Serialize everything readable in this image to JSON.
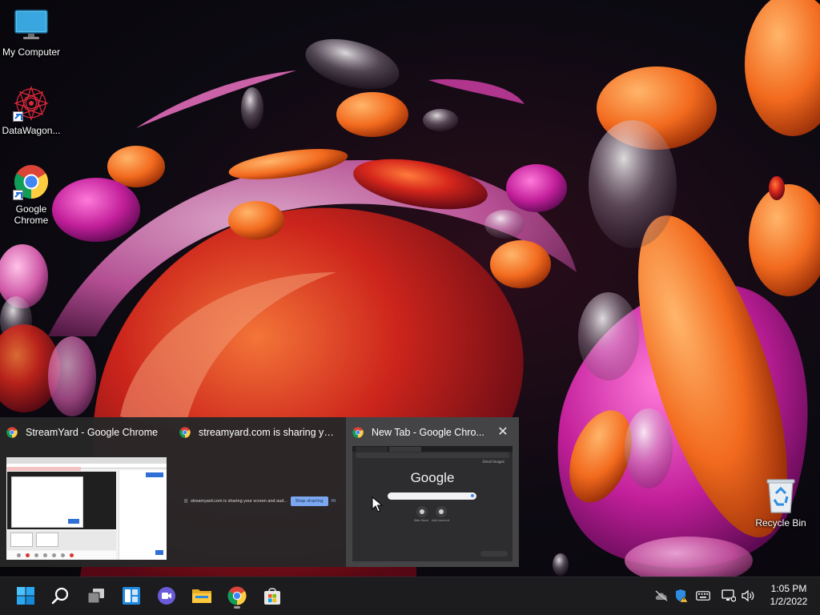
{
  "desktop": {
    "icons": [
      {
        "label": "My Computer",
        "icon": "monitor-icon"
      },
      {
        "label": "DataWagon...",
        "icon": "datawagon-icon"
      },
      {
        "label": "Google Chrome",
        "icon": "chrome-icon"
      },
      {
        "label": "Recycle Bin",
        "icon": "recycle-bin-icon"
      }
    ]
  },
  "task_preview": {
    "windows": [
      {
        "title": "StreamYard - Google Chrome",
        "icon": "chrome-icon"
      },
      {
        "title": "streamyard.com is sharing yo...",
        "icon": "chrome-icon",
        "preview": {
          "pause": "II",
          "message": "streamyard.com is sharing your screen and aud...",
          "stop_label": "Stop sharing",
          "hide_label": "Hi"
        }
      },
      {
        "title": "New Tab - Google Chro...",
        "icon": "chrome-icon",
        "preview": {
          "logo": "Google",
          "links": "Gmail  Images",
          "shortcut_1": "Web Store",
          "shortcut_2": "Add shortcut"
        }
      }
    ],
    "close_label": "✕"
  },
  "taskbar": {
    "apps": [
      {
        "name": "Start",
        "icon": "windows-start-icon"
      },
      {
        "name": "Search",
        "icon": "search-icon"
      },
      {
        "name": "Task View",
        "icon": "task-view-icon"
      },
      {
        "name": "Widgets",
        "icon": "widgets-icon"
      },
      {
        "name": "Chat",
        "icon": "chat-icon"
      },
      {
        "name": "File Explorer",
        "icon": "folder-icon"
      },
      {
        "name": "Google Chrome",
        "icon": "chrome-icon"
      },
      {
        "name": "Microsoft Store",
        "icon": "store-icon"
      }
    ],
    "tray": [
      "onedrive-icon",
      "security-icon",
      "keyboard-icon",
      "network-icon",
      "volume-icon"
    ],
    "clock": {
      "time": "1:05 PM",
      "date": "1/2/2022"
    }
  },
  "colors": {
    "taskbar": "#1c1c1f",
    "preview_panel": "#262628",
    "accent": "#2f6fd6"
  }
}
